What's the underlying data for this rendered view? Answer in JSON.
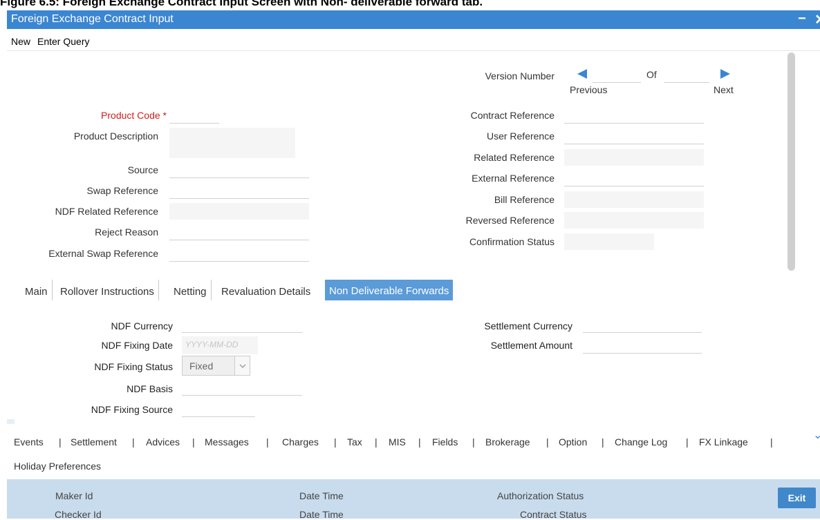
{
  "caption": "Figure 6.5: Foreign Exchange Contract Input Screen with Non- deliverable forward tab.",
  "window": {
    "title": "Foreign Exchange Contract Input",
    "minimize": "−",
    "close": "✕"
  },
  "menu": {
    "new": "New",
    "enter_query": "Enter Query"
  },
  "version": {
    "label": "Version Number",
    "of": "Of",
    "previous": "Previous",
    "next": "Next"
  },
  "left_fields": {
    "product_code": "Product Code",
    "product_code_req": "*",
    "product_description": "Product Description",
    "source": "Source",
    "swap_reference": "Swap Reference",
    "ndf_related_reference": "NDF Related Reference",
    "reject_reason": "Reject Reason",
    "external_swap_reference": "External Swap Reference"
  },
  "right_fields": {
    "contract_reference": "Contract Reference",
    "user_reference": "User Reference",
    "related_reference": "Related Reference",
    "external_reference": "External Reference",
    "bill_reference": "Bill Reference",
    "reversed_reference": "Reversed Reference",
    "confirmation_status": "Confirmation Status"
  },
  "tabs": [
    "Main",
    "Rollover Instructions",
    "Netting",
    "Revaluation Details",
    "Non Deliverable Forwards"
  ],
  "ndf": {
    "currency": "NDF Currency",
    "fixing_date": "NDF Fixing Date",
    "fixing_date_placeholder": "YYYY-MM-DD",
    "fixing_status": "NDF Fixing Status",
    "fixing_status_value": "Fixed",
    "basis": "NDF Basis",
    "fixing_source": "NDF Fixing Source",
    "settlement_currency": "Settlement Currency",
    "settlement_amount": "Settlement Amount"
  },
  "subsystems": {
    "row1": [
      "Events",
      "Settlement",
      "Advices",
      "Messages",
      "Charges",
      "Tax",
      "MIS",
      "Fields",
      "Brokerage",
      "Option",
      "Change Log",
      "FX Linkage"
    ],
    "row2": [
      "Holiday Preferences"
    ],
    "expand_icon": "⌄"
  },
  "footer": {
    "maker_id": "Maker Id",
    "checker_id": "Checker Id",
    "date_time_1": "Date Time",
    "date_time_2": "Date Time",
    "authorization_status": "Authorization Status",
    "contract_status": "Contract Status",
    "exit": "Exit"
  },
  "colors": {
    "title_bar": "#3b86d1",
    "active_tab": "#5b9bd8",
    "footer": "#c9dcee",
    "required": "#d51a1a"
  },
  "icons": {
    "previous": "left-triangle-icon",
    "next": "right-triangle-icon",
    "dropdown": "chevron-down-icon"
  }
}
